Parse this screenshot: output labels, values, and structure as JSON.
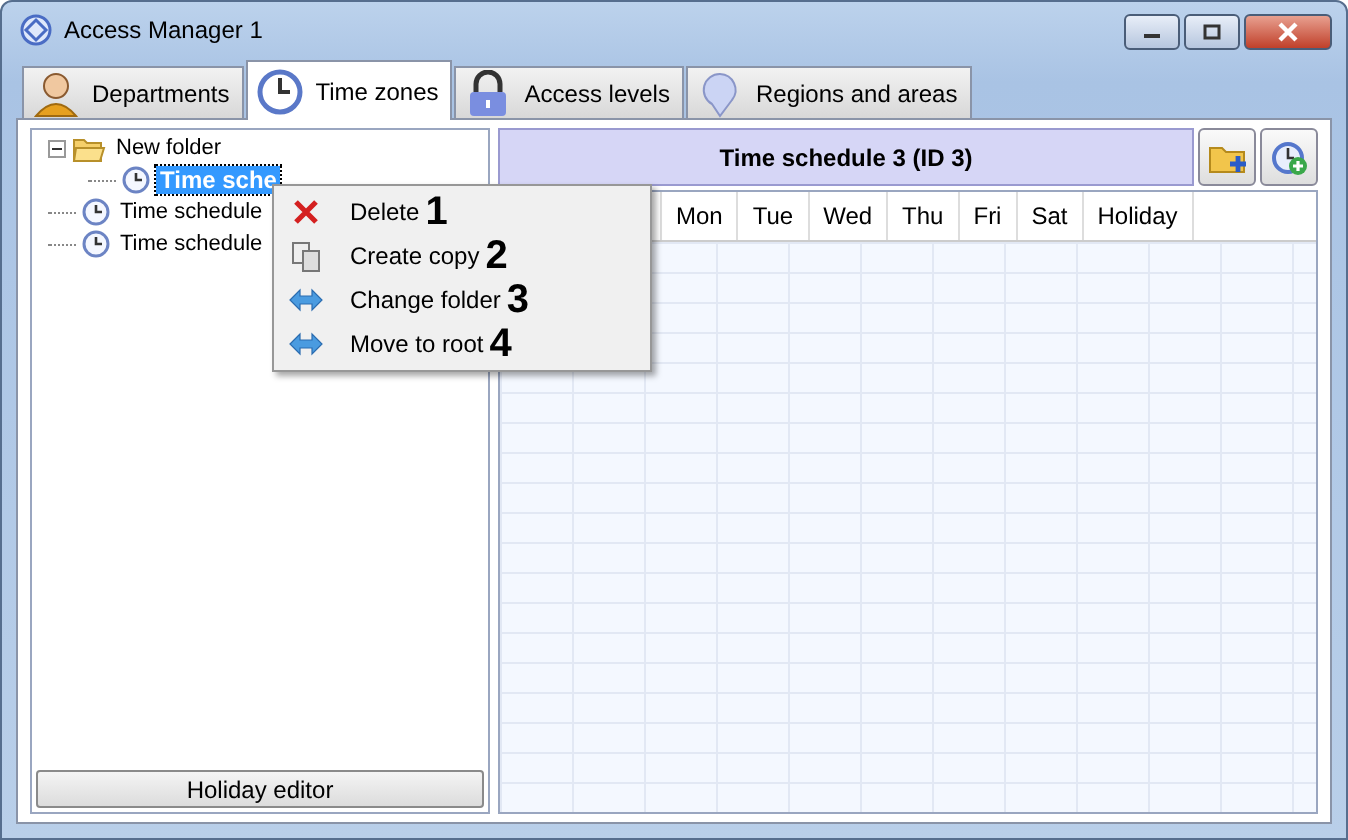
{
  "window": {
    "title": "Access Manager 1"
  },
  "tabs": [
    {
      "label": "Departments",
      "selected": false
    },
    {
      "label": "Time zones",
      "selected": true
    },
    {
      "label": "Access levels",
      "selected": false
    },
    {
      "label": "Regions and areas",
      "selected": false
    }
  ],
  "tree": [
    {
      "label": "New folder",
      "kind": "folder",
      "expanded": true,
      "selected": false,
      "children": [
        {
          "label": "Time sche",
          "kind": "schedule",
          "selected": true
        }
      ]
    },
    {
      "label": "Time schedule",
      "kind": "schedule",
      "selected": false
    },
    {
      "label": "Time schedule",
      "kind": "schedule",
      "selected": false
    }
  ],
  "holiday_button": "Holiday editor",
  "schedule": {
    "title": "Time schedule 3 (ID 3)",
    "columns": [
      "Mon",
      "Tue",
      "Wed",
      "Thu",
      "Fri",
      "Sat",
      "Holiday"
    ]
  },
  "context_menu": [
    {
      "label": "Delete",
      "number": "1"
    },
    {
      "label": "Create copy",
      "number": "2"
    },
    {
      "label": "Change folder",
      "number": "3"
    },
    {
      "label": "Move to root",
      "number": "4"
    }
  ]
}
